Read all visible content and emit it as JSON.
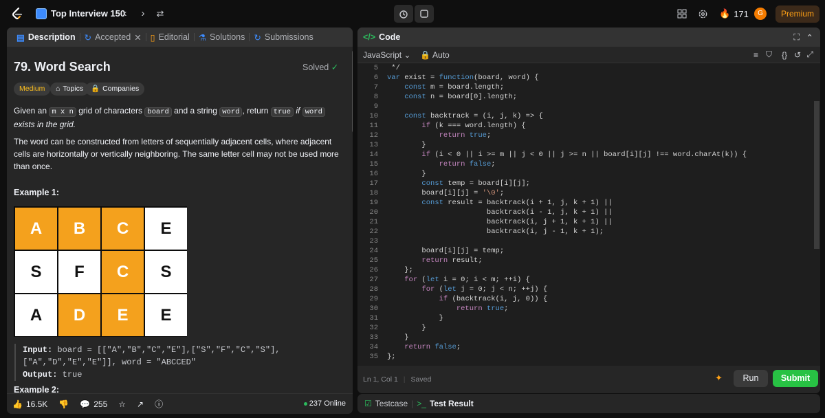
{
  "topbar": {
    "list_title": "Top Interview 150",
    "streak": "171",
    "avatar_letter": "G",
    "premium_label": "Premium"
  },
  "left": {
    "tabs": [
      {
        "label": "Description"
      },
      {
        "label": "Accepted"
      },
      {
        "label": "Editorial"
      },
      {
        "label": "Solutions"
      },
      {
        "label": "Submissions"
      }
    ],
    "title": "79. Word Search",
    "solved": "Solved",
    "chips": {
      "difficulty": "Medium",
      "topics": "Topics",
      "companies": "Companies"
    },
    "desc1": {
      "a": "Given an",
      "b": "m x n",
      "c": "grid of characters",
      "d": "board",
      "e": "and a string",
      "f": "word",
      "g": ", return",
      "h": "true",
      "i": "if",
      "j": "word",
      "k": "exists in the grid."
    },
    "desc2": "The word can be constructed from letters of sequentially adjacent cells, where adjacent cells are horizontally or vertically neighboring. The same letter cell may not be used more than once.",
    "example1_title": "Example 1:",
    "grid": [
      {
        "ch": "A",
        "hl": true
      },
      {
        "ch": "B",
        "hl": true
      },
      {
        "ch": "C",
        "hl": true
      },
      {
        "ch": "E",
        "hl": false
      },
      {
        "ch": "S",
        "hl": false
      },
      {
        "ch": "F",
        "hl": false
      },
      {
        "ch": "C",
        "hl": true
      },
      {
        "ch": "S",
        "hl": false
      },
      {
        "ch": "A",
        "hl": false
      },
      {
        "ch": "D",
        "hl": true
      },
      {
        "ch": "E",
        "hl": true
      },
      {
        "ch": "E",
        "hl": false
      }
    ],
    "input_label": "Input:",
    "input_value": "board = [[\"A\",\"B\",\"C\",\"E\"],[\"S\",\"F\",\"C\",\"S\"],",
    "input_value2": "[\"A\",\"D\",\"E\",\"E\"]], word = \"ABCCED\"",
    "output_label": "Output:",
    "output_value": "true",
    "example2_title": "Example 2:",
    "likes": "16.5K",
    "comments": "255",
    "online": "237 Online"
  },
  "code": {
    "header": "Code",
    "language": "JavaScript",
    "mode": "Auto",
    "lines": [
      {
        "n": "5",
        "t": " */"
      },
      {
        "n": "6",
        "t": "var exist = function(board, word) {"
      },
      {
        "n": "7",
        "t": "    const m = board.length;"
      },
      {
        "n": "8",
        "t": "    const n = board[0].length;"
      },
      {
        "n": "9",
        "t": ""
      },
      {
        "n": "10",
        "t": "    const backtrack = (i, j, k) => {"
      },
      {
        "n": "11",
        "t": "        if (k === word.length) {"
      },
      {
        "n": "12",
        "t": "            return true;"
      },
      {
        "n": "13",
        "t": "        }"
      },
      {
        "n": "14",
        "t": "        if (i < 0 || i >= m || j < 0 || j >= n || board[i][j] !== word.charAt(k)) {"
      },
      {
        "n": "15",
        "t": "            return false;"
      },
      {
        "n": "16",
        "t": "        }"
      },
      {
        "n": "17",
        "t": "        const temp = board[i][j];"
      },
      {
        "n": "18",
        "t": "        board[i][j] = '\\0';"
      },
      {
        "n": "19",
        "t": "        const result = backtrack(i + 1, j, k + 1) ||"
      },
      {
        "n": "20",
        "t": "                       backtrack(i - 1, j, k + 1) ||"
      },
      {
        "n": "21",
        "t": "                       backtrack(i, j + 1, k + 1) ||"
      },
      {
        "n": "22",
        "t": "                       backtrack(i, j - 1, k + 1);"
      },
      {
        "n": "23",
        "t": ""
      },
      {
        "n": "24",
        "t": "        board[i][j] = temp;"
      },
      {
        "n": "25",
        "t": "        return result;"
      },
      {
        "n": "26",
        "t": "    };"
      },
      {
        "n": "27",
        "t": "    for (let i = 0; i < m; ++i) {"
      },
      {
        "n": "28",
        "t": "        for (let j = 0; j < n; ++j) {"
      },
      {
        "n": "29",
        "t": "            if (backtrack(i, j, 0)) {"
      },
      {
        "n": "30",
        "t": "                return true;"
      },
      {
        "n": "31",
        "t": "            }"
      },
      {
        "n": "32",
        "t": "        }"
      },
      {
        "n": "33",
        "t": "    }"
      },
      {
        "n": "34",
        "t": "    return false;"
      },
      {
        "n": "35",
        "t": "};"
      }
    ],
    "cursor": "Ln 1, Col 1",
    "saved": "Saved",
    "run_label": "Run",
    "submit_label": "Submit"
  },
  "bottom": {
    "testcase": "Testcase",
    "test_result": "Test Result"
  }
}
